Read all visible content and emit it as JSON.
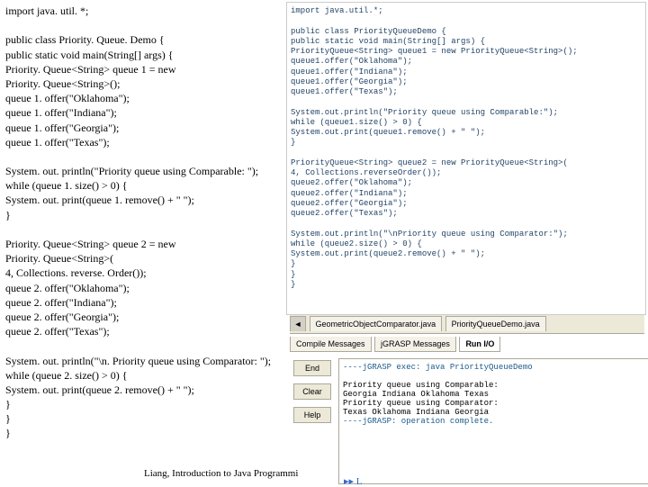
{
  "left": {
    "l01": "import java. util. *;",
    "l02": "public class Priority. Queue. Demo {",
    "l03": "  public static void main(String[] args) {",
    "l04": "    Priority. Queue<String> queue 1 = new",
    "l05": "Priority. Queue<String>();",
    "l06": "    queue 1. offer(\"Oklahoma\");",
    "l07": "    queue 1. offer(\"Indiana\");",
    "l08": "    queue 1. offer(\"Georgia\");",
    "l09": "    queue 1. offer(\"Texas\");",
    "l10": "    System. out. println(\"Priority queue using Comparable: \");",
    "l11": "    while (queue 1. size() > 0) {",
    "l12": "      System. out. print(queue 1. remove() + \" \");",
    "l13": "    }",
    "l14": "    Priority. Queue<String> queue 2 = new",
    "l15": "Priority. Queue<String>(",
    "l16": "      4, Collections. reverse. Order());",
    "l17": "    queue 2. offer(\"Oklahoma\");",
    "l18": "    queue 2. offer(\"Indiana\");",
    "l19": "    queue 2. offer(\"Georgia\");",
    "l20": "    queue 2. offer(\"Texas\");",
    "l21": "    System. out. println(\"\\n. Priority queue using Comparator: \");",
    "l22": "    while (queue 2. size() > 0) {",
    "l23": "      System. out. print(queue 2. remove() + \" \");",
    "l24": "    }",
    "l25": "  }",
    "l26": "}"
  },
  "right": {
    "l01": "import java.util.*;",
    "l02": "public class PriorityQueueDemo {",
    "l03": "  public static void main(String[] args) {",
    "l04": "    PriorityQueue<String> queue1 = new PriorityQueue<String>();",
    "l05": "    queue1.offer(\"Oklahoma\");",
    "l06": "    queue1.offer(\"Indiana\");",
    "l07": "    queue1.offer(\"Georgia\");",
    "l08": "    queue1.offer(\"Texas\");",
    "l09": "    System.out.println(\"Priority queue using Comparable:\");",
    "l10": "    while (queue1.size() > 0) {",
    "l11": "      System.out.print(queue1.remove() + \" \");",
    "l12": "    }",
    "l13": "    PriorityQueue<String> queue2 = new PriorityQueue<String>(",
    "l14": "      4, Collections.reverseOrder());",
    "l15": "    queue2.offer(\"Oklahoma\");",
    "l16": "    queue2.offer(\"Indiana\");",
    "l17": "    queue2.offer(\"Georgia\");",
    "l18": "    queue2.offer(\"Texas\");",
    "l19": "    System.out.println(\"\\nPriority queue using Comparator:\");",
    "l20": "    while (queue2.size() > 0) {",
    "l21": "      System.out.print(queue2.remove() + \" \");",
    "l22": "    }",
    "l23": "  }",
    "l24": "}"
  },
  "ide": {
    "filetab_left": "◄",
    "filetab1": "GeometricObjectComparator.java",
    "filetab2": "PriorityQueueDemo.java",
    "msgtab1": "Compile Messages",
    "msgtab2": "jGRASP Messages",
    "msgtab3": "Run I/O",
    "btn_end": "End",
    "btn_clear": "Clear",
    "btn_help": "Help",
    "exec": "    ----jGRASP exec: java PriorityQueueDemo",
    "out1": "Priority queue using Comparable:",
    "out2": "Georgia Indiana Oklahoma Texas",
    "out3": "Priority queue using Comparator:",
    "out4": "Texas Oklahoma Indiana Georgia",
    "done": "    ----jGRASP: operation complete.",
    "cursor": "▸▸  L"
  },
  "footer": "Liang, Introduction to Java Programmi"
}
